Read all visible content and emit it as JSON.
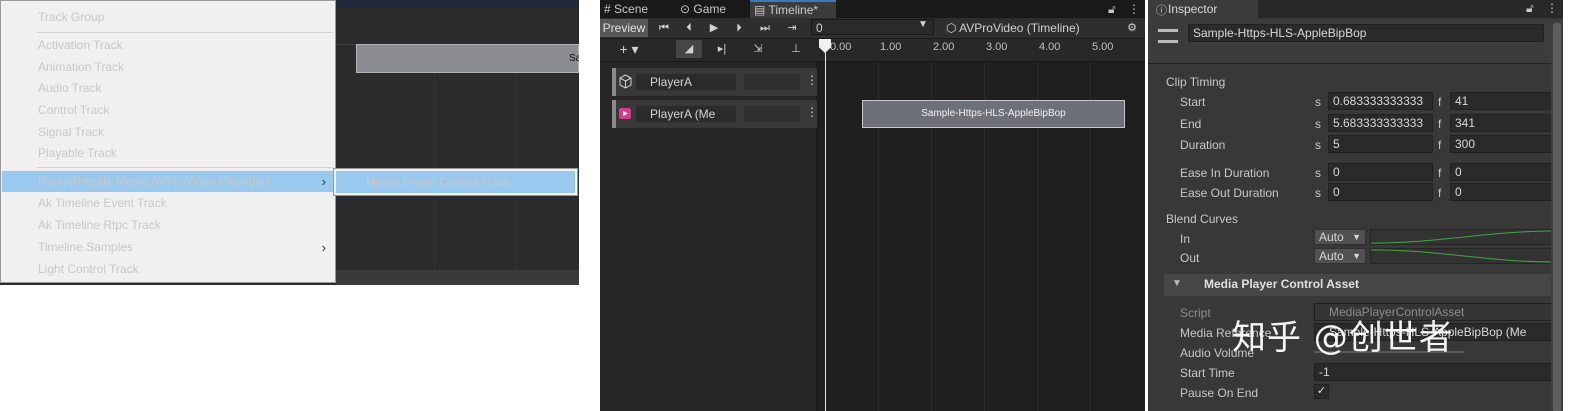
{
  "left_menu": {
    "items": [
      {
        "label": "Track Group"
      },
      {
        "label": "Activation Track"
      },
      {
        "label": "Animation Track"
      },
      {
        "label": "Audio Track"
      },
      {
        "label": "Control Track"
      },
      {
        "label": "Signal Track"
      },
      {
        "label": "Playable Track"
      },
      {
        "label": "RenderHeads.Media.AVProVideo.Playables",
        "arrow": "›"
      },
      {
        "label": "Ak Timeline Event Track"
      },
      {
        "label": "Ak Timeline Rtpc Track"
      },
      {
        "label": "Timeline.Samples",
        "arrow": "›"
      },
      {
        "label": "Light Control Track"
      }
    ],
    "submenu_item": "Media Player Control Track",
    "background_clip_label": "Sa"
  },
  "timeline": {
    "tabs": {
      "scene": "Scene",
      "game": "Game",
      "timeline": "Timeline*"
    },
    "preview_label": "Preview",
    "frame_value": "0",
    "asset_name": "AVProVideo (Timeline)",
    "ruler_ticks": [
      "0.00",
      "1.00",
      "2.00",
      "3.00",
      "4.00",
      "5.00"
    ],
    "tracks": [
      {
        "name": "PlayerA"
      },
      {
        "name": "PlayerA (Me"
      }
    ],
    "clip_label": "Sample-Https-HLS-AppleBipBop"
  },
  "inspector": {
    "tab_label": "Inspector",
    "object_name": "Sample-Https-HLS-AppleBipBop",
    "clip_timing": {
      "heading": "Clip Timing",
      "start": {
        "label": "Start",
        "s": "0.683333333333",
        "f": "41"
      },
      "end": {
        "label": "End",
        "s": "5.683333333333",
        "f": "341"
      },
      "duration": {
        "label": "Duration",
        "s": "5",
        "f": "300"
      },
      "ease_in": {
        "label": "Ease In Duration",
        "s": "0",
        "f": "0"
      },
      "ease_out": {
        "label": "Ease Out Duration",
        "s": "0",
        "f": "0"
      },
      "s_unit": "s",
      "f_unit": "f"
    },
    "blend_curves": {
      "heading": "Blend Curves",
      "in": {
        "label": "In",
        "mode": "Auto"
      },
      "out": {
        "label": "Out",
        "mode": "Auto"
      }
    },
    "asset_section": {
      "title": "Media Player Control Asset",
      "script": {
        "label": "Script",
        "value": "MediaPlayerControlAsset"
      },
      "media_reference": {
        "label": "Media Reference",
        "value": "Sample-Https-HLS-AppleBipBop (Me"
      },
      "audio_volume": {
        "label": "Audio Volume"
      },
      "start_time": {
        "label": "Start Time",
        "value": "-1"
      },
      "pause_on_end": {
        "label": "Pause On End",
        "checked": true
      }
    }
  },
  "watermark": "知乎 @创世者"
}
